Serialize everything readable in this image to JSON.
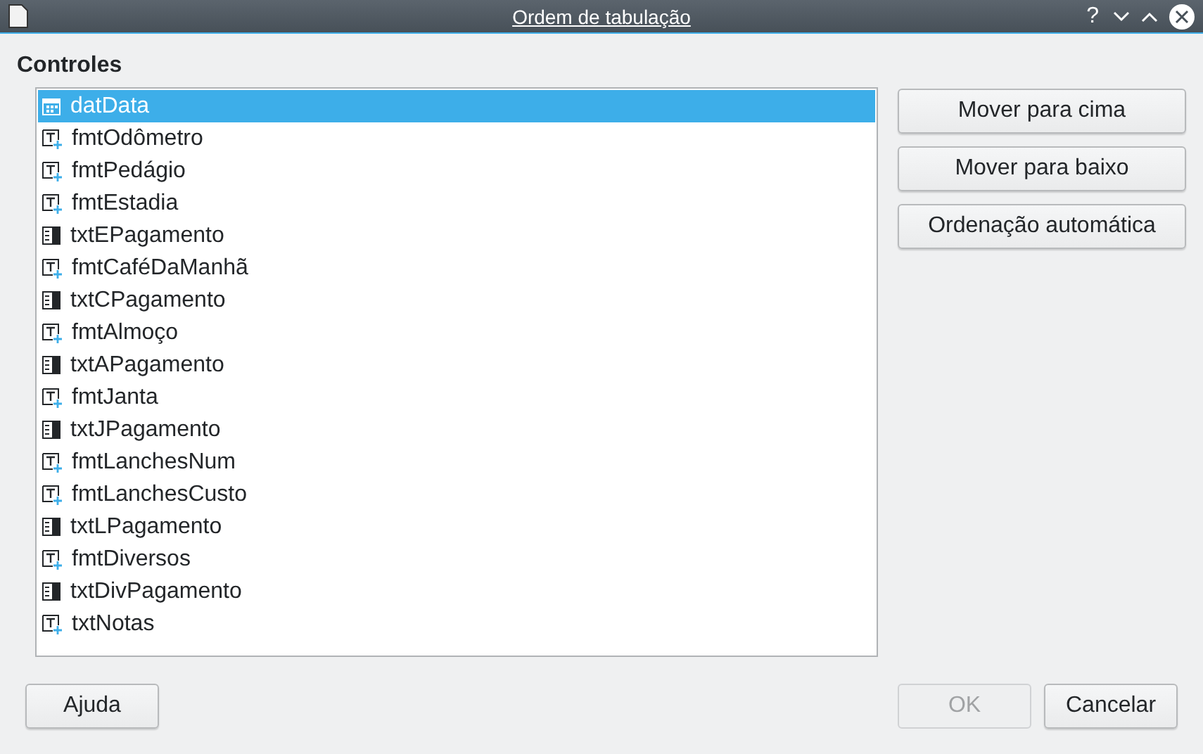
{
  "window": {
    "title": "Ordem de tabulação"
  },
  "section_title": "Controles",
  "controls": [
    {
      "label": "datData",
      "kind": "date",
      "selected": true
    },
    {
      "label": "fmtOdômetro",
      "kind": "formatted",
      "selected": false
    },
    {
      "label": "fmtPedágio",
      "kind": "formatted",
      "selected": false
    },
    {
      "label": "fmtEstadia",
      "kind": "formatted",
      "selected": false
    },
    {
      "label": "txtEPagamento",
      "kind": "text",
      "selected": false
    },
    {
      "label": "fmtCaféDaManhã",
      "kind": "formatted",
      "selected": false
    },
    {
      "label": "txtCPagamento",
      "kind": "text",
      "selected": false
    },
    {
      "label": "fmtAlmoço",
      "kind": "formatted",
      "selected": false
    },
    {
      "label": "txtAPagamento",
      "kind": "text",
      "selected": false
    },
    {
      "label": "fmtJanta",
      "kind": "formatted",
      "selected": false
    },
    {
      "label": "txtJPagamento",
      "kind": "text",
      "selected": false
    },
    {
      "label": "fmtLanchesNum",
      "kind": "formatted",
      "selected": false
    },
    {
      "label": "fmtLanchesCusto",
      "kind": "formatted",
      "selected": false
    },
    {
      "label": "txtLPagamento",
      "kind": "text",
      "selected": false
    },
    {
      "label": "fmtDiversos",
      "kind": "formatted",
      "selected": false
    },
    {
      "label": "txtDivPagamento",
      "kind": "text",
      "selected": false
    },
    {
      "label": "txtNotas",
      "kind": "formatted",
      "selected": false
    }
  ],
  "side_buttons": [
    {
      "label": "Mover para cima",
      "disabled": false
    },
    {
      "label": "Mover para baixo",
      "disabled": false
    },
    {
      "label": "Ordenação automática",
      "disabled": false
    }
  ],
  "help_button": {
    "label": "Ajuda",
    "disabled": false
  },
  "dialog_buttons": [
    {
      "label": "OK",
      "disabled": true
    },
    {
      "label": "Cancelar",
      "disabled": false
    }
  ],
  "title_buttons": [
    "?"
  ]
}
